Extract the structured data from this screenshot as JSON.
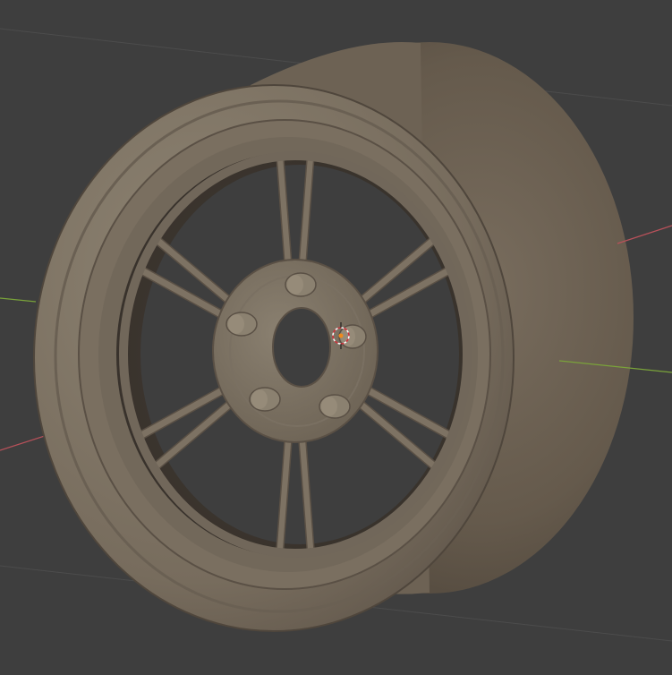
{
  "viewport": {
    "background": "#3e3e3e",
    "grid_line_color": "#4a4a4a",
    "x_axis_color": "#b8515a",
    "y_axis_color": "#7aa33a",
    "object": "wheel-rim-with-tire",
    "object_color": "#7d7263",
    "rim_color": "#83796a",
    "spoke_count": 12,
    "lug_count": 5,
    "cursor_icon": "3d-cursor-icon",
    "origin_color": "#f08a1c"
  }
}
